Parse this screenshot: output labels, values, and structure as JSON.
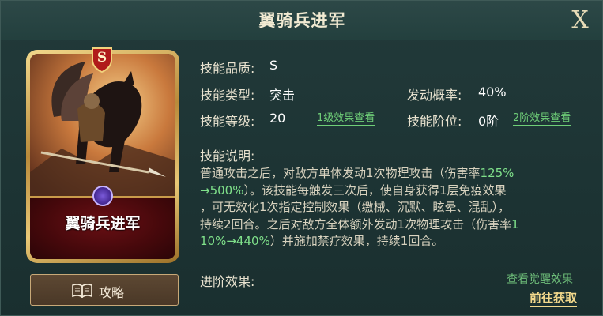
{
  "header": {
    "title": "翼骑兵进军",
    "close_label": "X"
  },
  "card": {
    "name": "翼骑兵进军",
    "grade": "S"
  },
  "guide_button": {
    "label": "攻略"
  },
  "info": {
    "quality_label": "技能品质:",
    "quality_value": "S",
    "type_label": "技能类型:",
    "type_value": "突击",
    "chance_label": "发动概率:",
    "chance_value": "40%",
    "level_label": "技能等级:",
    "level_value": "20",
    "level_link": "1级效果查看",
    "tier_label": "技能阶位:",
    "tier_value": "0阶",
    "tier_link": "2阶效果查看",
    "desc_label": "技能说明:",
    "desc_lines": [
      [
        "普通攻击之后，对敌方单体发动1次物理攻击（伤害率",
        "125%"
      ],
      [
        "→500%",
        "）。该技能每触发三次后，使自身获得1层免疫效果"
      ],
      [
        "，可无效化1次指定控制效果（缴械、沉默、眩晕、混乱），"
      ],
      [
        "持续2回合。之后对敌方全体额外发动1次物理攻击（伤害率",
        "1"
      ],
      [
        "10%→440%",
        "）并施加禁疗效果，持续1回合。"
      ]
    ],
    "advance_label": "进阶效果:",
    "awaken_link": "查看觉醒效果",
    "goto_link": "前往获取"
  }
}
